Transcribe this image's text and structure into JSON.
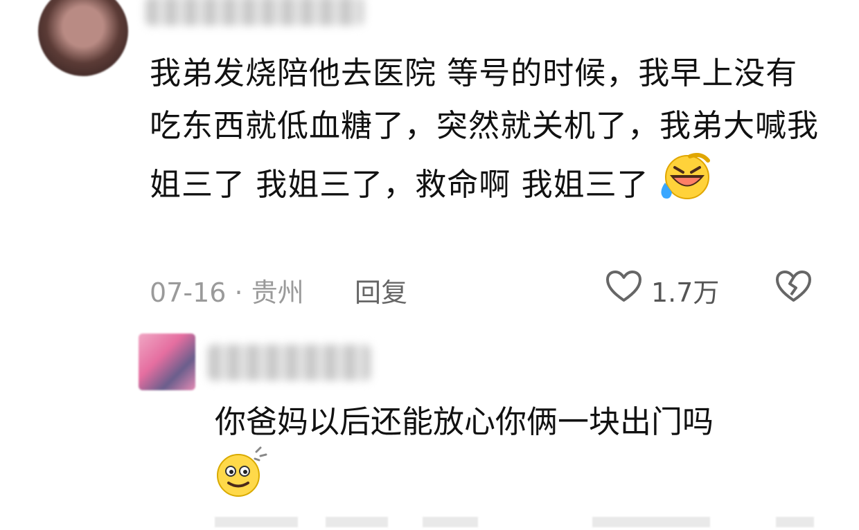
{
  "comments": [
    {
      "avatar": "user-avatar-1",
      "text": "我弟发烧陪他去医院  等号的时候，我早上没有吃东西就低血糖了，突然就关机了，我弟大喊我姐三了  我姐三了，救命啊  我姐三了",
      "emoji": "laughing-crying-emoji",
      "date": "07-16",
      "separator": "·",
      "location": "贵州",
      "reply_label": "回复",
      "likes": "1.7万"
    },
    {
      "avatar": "user-avatar-2",
      "text": "你爸妈以后还能放心你俩一块出门吗",
      "emoji": "dizzy-smile-emoji"
    }
  ]
}
